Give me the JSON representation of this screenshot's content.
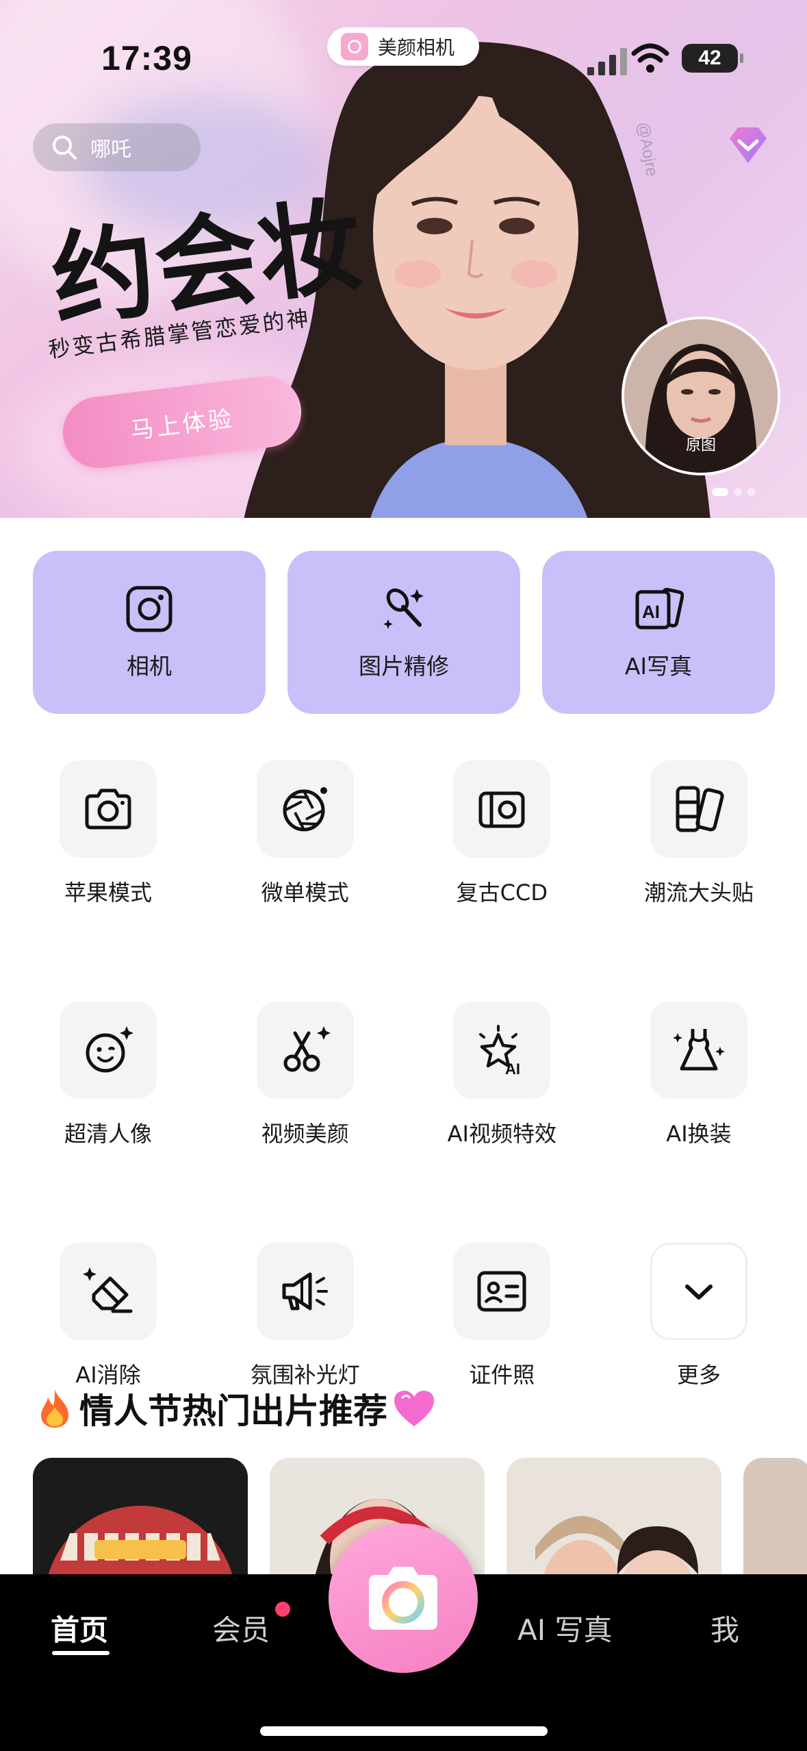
{
  "status_bar": {
    "time": "17:39",
    "app_pill": "美颜相机",
    "battery": "42"
  },
  "hero": {
    "search_placeholder": "哪吒",
    "title": "约会妆",
    "subtitle": "秒变古希腊掌管恋爱的神",
    "cta": "马上体验",
    "watermark": "@Aojre",
    "original_label": "原图"
  },
  "big_tiles": [
    {
      "label": "相机",
      "icon": "camera-icon"
    },
    {
      "label": "图片精修",
      "icon": "brush-icon"
    },
    {
      "label": "AI写真",
      "icon": "ai-photo-icon"
    }
  ],
  "grid": [
    {
      "label": "苹果模式",
      "icon": "camera-outline-icon"
    },
    {
      "label": "微单模式",
      "icon": "aperture-icon"
    },
    {
      "label": "复古CCD",
      "icon": "ccd-camera-icon"
    },
    {
      "label": "潮流大头贴",
      "icon": "photo-strip-icon"
    },
    {
      "label": "超清人像",
      "icon": "smile-face-icon"
    },
    {
      "label": "视频美颜",
      "icon": "scissors-icon"
    },
    {
      "label": "AI视频特效",
      "icon": "ai-star-icon"
    },
    {
      "label": "AI换装",
      "icon": "dress-icon"
    },
    {
      "label": "AI消除",
      "icon": "eraser-icon"
    },
    {
      "label": "氛围补光灯",
      "icon": "megaphone-light-icon"
    },
    {
      "label": "证件照",
      "icon": "id-card-icon"
    },
    {
      "label": "更多",
      "icon": "chevron-down-icon"
    }
  ],
  "section": {
    "title": "情人节热门出片推荐",
    "leading_emoji": "fire-icon",
    "trailing_emoji": "heart-icon"
  },
  "bottom_nav": {
    "items": [
      "首页",
      "会员",
      "AI 写真",
      "我"
    ],
    "active": "首页"
  },
  "colors": {
    "tile_bg": "#c8c0f9",
    "accent_pink": "#f680c4",
    "nav_bg": "#000000"
  }
}
